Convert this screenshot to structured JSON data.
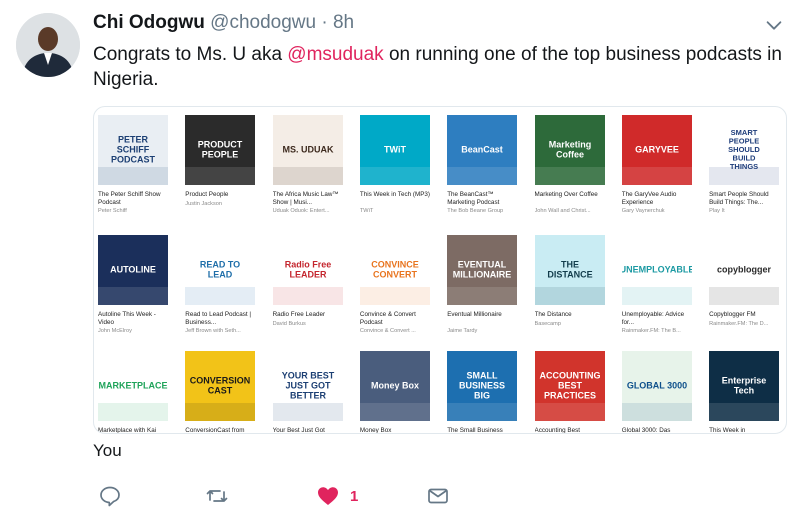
{
  "tweet": {
    "author_name": "Chi Odogwu",
    "handle": "@chodogwu",
    "separator": "·",
    "time": "8h",
    "text_before": "Congrats to Ms. U aka ",
    "mention": "@msuduak",
    "text_after": " on running one of the top business podcasts in Nigeria.",
    "reply_text": "You",
    "like_count": "1",
    "liked": true
  },
  "podcasts": [
    {
      "title": "The Peter Schiff Show Podcast",
      "author": "Peter Schiff",
      "cover_text": "PETER SCHIFF PODCAST",
      "bg": "#e9eef3",
      "fg": "#1c3f73"
    },
    {
      "title": "Product People",
      "author": "Justin Jackson",
      "cover_text": "PRODUCT PEOPLE",
      "bg": "#2b2b2b",
      "fg": "#ffffff"
    },
    {
      "title": "The Africa Music Law™ Show | Musi...",
      "author": "Uduak Oduok: Entert...",
      "cover_text": "MS. UDUAK",
      "bg": "#f4ede6",
      "fg": "#3d2a1e"
    },
    {
      "title": "This Week in Tech (MP3)",
      "author": "TWiT",
      "cover_text": "TWiT",
      "bg": "#00a9c7",
      "fg": "#ffffff"
    },
    {
      "title": "The BeanCast™ Marketing Podcast",
      "author": "The Bob Beane Group",
      "cover_text": "BeanCast",
      "bg": "#2e7ec0",
      "fg": "#ffffff"
    },
    {
      "title": "Marketing Over Coffee",
      "author": "John Wall and Christ...",
      "cover_text": "Marketing Coffee",
      "bg": "#2d6a3a",
      "fg": "#ffffff"
    },
    {
      "title": "The GaryVee Audio Experience",
      "author": "Gary Vaynerchuk",
      "cover_text": "GARYVEE",
      "bg": "#d02a2a",
      "fg": "#ffffff"
    },
    {
      "title": "Smart People Should Build Things: The...",
      "author": "Play It",
      "cover_text": "SMART PEOPLE SHOULD BUILD THINGS",
      "bg": "#ffffff",
      "fg": "#1d3c7a"
    },
    {
      "title": "Autoline This Week - Video",
      "author": "John McElroy",
      "cover_text": "AUTOLINE",
      "bg": "#1b2f5b",
      "fg": "#ffffff"
    },
    {
      "title": "Read to Lead Podcast | Business...",
      "author": "Jeff Brown with Seth...",
      "cover_text": "READ TO LEAD",
      "bg": "#ffffff",
      "fg": "#1e6ea9"
    },
    {
      "title": "Radio Free Leader",
      "author": "David Burkus",
      "cover_text": "Radio Free LEADER",
      "bg": "#ffffff",
      "fg": "#c4262e"
    },
    {
      "title": "Convince & Convert Podcast",
      "author": "Convince & Convert ...",
      "cover_text": "CONVINCE CONVERT",
      "bg": "#ffffff",
      "fg": "#e8741e"
    },
    {
      "title": "Eventual Millionaire",
      "author": "Jaime Tardy",
      "cover_text": "EVENTUAL MILLIONAIRE",
      "bg": "#7d6b64",
      "fg": "#ffffff"
    },
    {
      "title": "The Distance",
      "author": "Basecamp",
      "cover_text": "THE DISTANCE",
      "bg": "#c9ecf3",
      "fg": "#123c4b"
    },
    {
      "title": "Unemployable: Advice for...",
      "author": "Rainmaker.FM: The B...",
      "cover_text": "UNEMPLOYABLE",
      "bg": "#ffffff",
      "fg": "#1c9aa3"
    },
    {
      "title": "Copyblogger FM",
      "author": "Rainmaker.FM: The D...",
      "cover_text": "copyblogger",
      "bg": "#ffffff",
      "fg": "#2a2a2a"
    },
    {
      "title": "Marketplace with Kai",
      "author": "",
      "cover_text": "MARKETPLACE",
      "bg": "#ffffff",
      "fg": "#1fa35a"
    },
    {
      "title": "ConversionCast from",
      "author": "",
      "cover_text": "CONVERSION CAST",
      "bg": "#f2c318",
      "fg": "#1a1a1a"
    },
    {
      "title": "Your Best Just Got",
      "author": "",
      "cover_text": "YOUR BEST JUST GOT BETTER",
      "bg": "#ffffff",
      "fg": "#1c3f73"
    },
    {
      "title": "Money Box",
      "author": "",
      "cover_text": "Money Box",
      "bg": "#4a5d7d",
      "fg": "#ffffff"
    },
    {
      "title": "The Small Business",
      "author": "",
      "cover_text": "SMALL BUSINESS BIG",
      "bg": "#1d6fb0",
      "fg": "#ffffff"
    },
    {
      "title": "Accounting Best",
      "author": "",
      "cover_text": "ACCOUNTING BEST PRACTICES",
      "bg": "#d1342c",
      "fg": "#ffffff"
    },
    {
      "title": "Global 3000: Das",
      "author": "",
      "cover_text": "GLOBAL 3000",
      "bg": "#e7f3ea",
      "fg": "#0d4f8b"
    },
    {
      "title": "This Week in",
      "author": "",
      "cover_text": "Enterprise Tech",
      "bg": "#0e2e46",
      "fg": "#ffffff"
    }
  ]
}
